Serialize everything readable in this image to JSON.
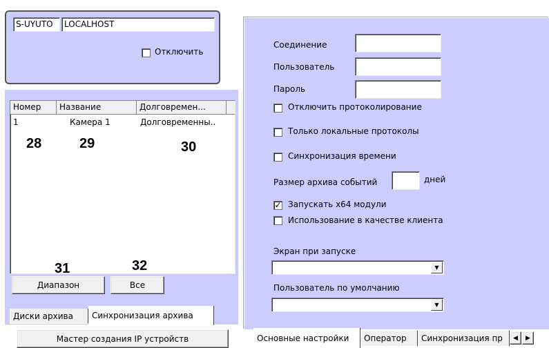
{
  "server": {
    "id": "S-UYUTO",
    "host": "LOCALHOST",
    "disable_label": "Отключить"
  },
  "table": {
    "columns": [
      "Номер",
      "Название",
      "Долговремен..."
    ],
    "rows": [
      {
        "num": "1",
        "name": "Камера 1",
        "long": "Долговременны.."
      }
    ]
  },
  "callouts": {
    "c28": "28",
    "c29": "29",
    "c30": "30",
    "c31": "31",
    "c32": "32"
  },
  "buttons": {
    "range": "Диапазон",
    "all": "Все",
    "wizard": "Мастер создания IP устройств"
  },
  "left_tabs": {
    "disks": "Диски архива",
    "sync": "Синхронизация архива"
  },
  "settings": {
    "connection_label": "Соединение",
    "connection_value": "",
    "user_label": "Пользователь",
    "user_value": "",
    "password_label": "Пароль",
    "password_value": "",
    "disable_logging": "Отключить протоколирование",
    "local_only": "Только локальные протоколы",
    "time_sync": "Синхронизация времени",
    "archive_size_label": "Размер архива событий",
    "archive_size_value": "",
    "days": "дней",
    "run_x64": "Запускать x64 модули",
    "run_x64_checked": true,
    "use_as_client": "Использование в качестве клиента",
    "startup_screen_label": "Экран при запуске",
    "startup_screen_value": "",
    "default_user_label": "Пользователь по умолчанию",
    "default_user_value": ""
  },
  "right_tabs": {
    "main": "Основные настройки",
    "operator": "Оператор",
    "sync": "Синхронизация пр"
  },
  "icons": {
    "dropdown": "triangle-down-icon",
    "checkmark": "check-icon",
    "scroll_left": "scroll-left-icon",
    "scroll_right": "scroll-right-icon"
  }
}
